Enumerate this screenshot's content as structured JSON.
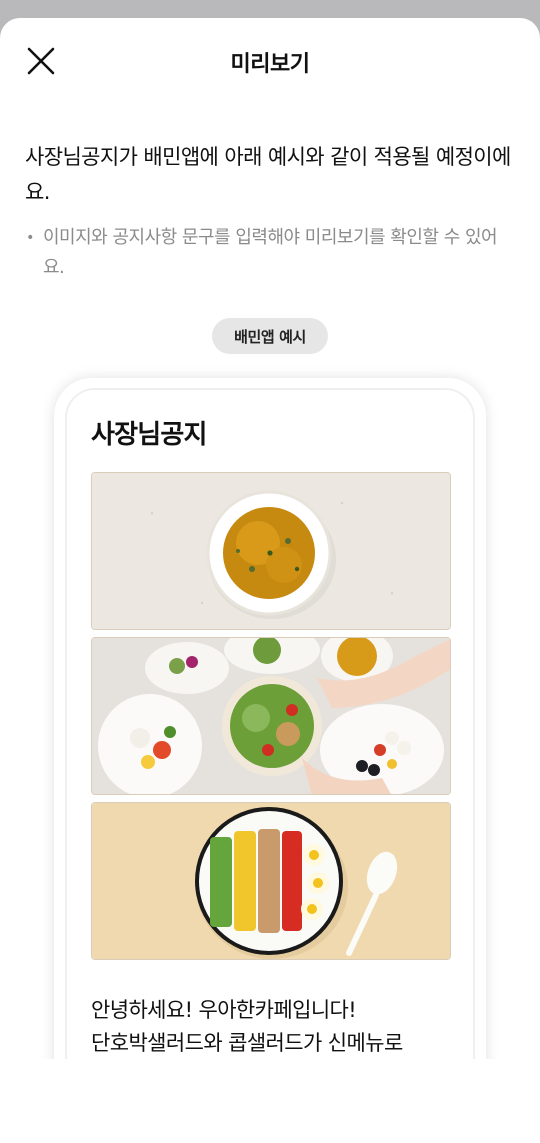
{
  "header": {
    "title": "미리보기",
    "close_icon": "close-icon"
  },
  "intro": {
    "text": "사장님공지가 배민앱에 아래 예시와 같이 적용될 예정이에요.",
    "note": "이미지와 공지사항 문구를 입력해야 미리보기를 확인할 수 있어요."
  },
  "preview": {
    "badge_label": "배민앱 예시",
    "notice_title": "사장님공지",
    "images": [
      "pumpkin-salad-image",
      "salad-spread-image",
      "cobb-salad-image"
    ],
    "body_line1": "안녕하세요! 우아한카페입니다!",
    "body_line2": "단호박샐러드와 콥샐러드가 신메뉴로"
  },
  "colors": {
    "backdrop": "#b9b9bb",
    "badge_bg": "#e6e6e6",
    "note_text": "#8b8b8b"
  }
}
